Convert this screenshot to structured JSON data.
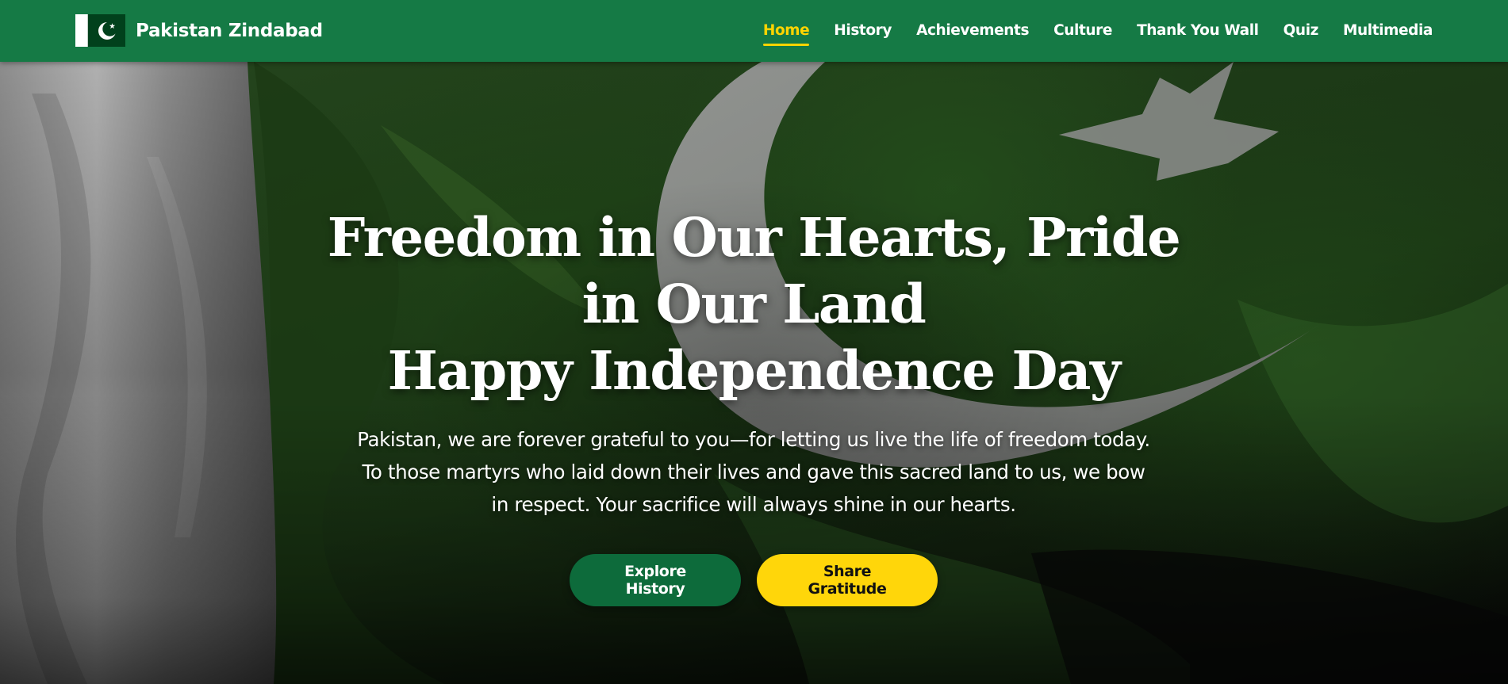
{
  "brand": {
    "name": "Pakistan Zindabad",
    "logo_icon": "pakistan-flag-icon"
  },
  "nav": {
    "items": [
      {
        "label": "Home",
        "active": true
      },
      {
        "label": "History",
        "active": false
      },
      {
        "label": "Achievements",
        "active": false
      },
      {
        "label": "Culture",
        "active": false
      },
      {
        "label": "Thank You Wall",
        "active": false
      },
      {
        "label": "Quiz",
        "active": false
      },
      {
        "label": "Multimedia",
        "active": false
      }
    ]
  },
  "hero": {
    "title_line1": "Freedom in Our Hearts, Pride",
    "title_line2": "in Our Land",
    "title_line3": "Happy Independence Day",
    "description": "Pakistan, we are forever grateful to you—for letting us live the life of freedom today. To those martyrs who laid down their lives and gave this sacred land to us, we bow in respect. Your sacrifice will always shine in our hearts.",
    "primary_button": "Explore History",
    "secondary_button": "Share Gratitude",
    "background": "waving-pakistan-flag"
  },
  "colors": {
    "navbar": "#157a45",
    "active_link": "#ffd400",
    "primary_button": "#0d6b3b",
    "secondary_button": "#ffd60a",
    "flag_green": "#01411c"
  }
}
